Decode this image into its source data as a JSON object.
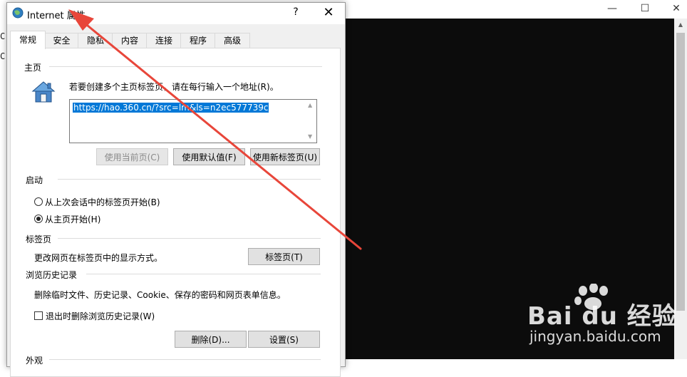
{
  "window": {
    "title": "Internet 属性",
    "help": "?",
    "close": "✕"
  },
  "background": {
    "minimize": "—",
    "maximize": "☐",
    "close": "✕",
    "left_glyphs": [
      "C",
      "C"
    ]
  },
  "tabs": [
    {
      "label": "常规",
      "active": true
    },
    {
      "label": "安全",
      "active": false
    },
    {
      "label": "隐私",
      "active": false
    },
    {
      "label": "内容",
      "active": false
    },
    {
      "label": "连接",
      "active": false
    },
    {
      "label": "程序",
      "active": false
    },
    {
      "label": "高级",
      "active": false
    }
  ],
  "home": {
    "section": "主页",
    "instruction": "若要创建多个主页标签页，请在每行输入一个地址(R)。",
    "url": "https://hao.360.cn/?src=lm&ls=n2ec577739c",
    "btn_current": "使用当前页(C)",
    "btn_default": "使用默认值(F)",
    "btn_newtab": "使用新标签页(U)"
  },
  "startup": {
    "section": "启动",
    "option_last": "从上次会话中的标签页开始(B)",
    "option_home": "从主页开始(H)"
  },
  "tabs_section": {
    "section": "标签页",
    "desc": "更改网页在标签页中的显示方式。",
    "btn": "标签页(T)"
  },
  "history": {
    "section": "浏览历史记录",
    "desc": "删除临时文件、历史记录、Cookie、保存的密码和网页表单信息。",
    "checkbox_label": "退出时删除浏览历史记录(W)",
    "btn_delete": "删除(D)...",
    "btn_settings": "设置(S)"
  },
  "appearance": {
    "section": "外观"
  },
  "watermark": {
    "brand": "Bai du 经验",
    "site": "jingyan.baidu.com"
  },
  "colors": {
    "arrow": "#e8463a",
    "selection": "#0078d7",
    "console": "#0c0c0c"
  }
}
